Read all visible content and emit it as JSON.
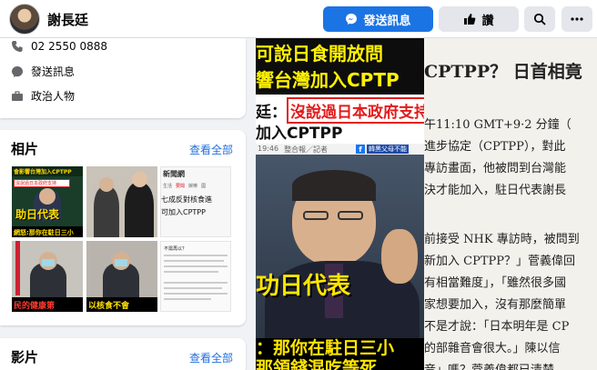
{
  "header": {
    "page_name": "謝長廷",
    "message_button": "發送訊息",
    "like_button": "讚",
    "search_icon": "search-icon",
    "more_icon": "more-icon",
    "accent": "#1b74e4"
  },
  "intro": {
    "phone": "02 2550 0888",
    "message": "發送訊息",
    "category": "政治人物"
  },
  "photos": {
    "title": "相片",
    "see_all": "查看全部",
    "thumb1": {
      "caption_top": "會影響台灣加入CPTPP",
      "red_text": "沒說過日本政府支持",
      "yellow_text": "助日代表",
      "bottom_text": "網怒:那你在駐日三小"
    },
    "thumb2": {},
    "thumb3": {
      "brand": "新聞網",
      "tabs": [
        "生活",
        "要聞",
        "娛樂",
        "國"
      ],
      "line1": "七成反對核食進",
      "line2": "可加入CPTPP"
    },
    "thumb4": {
      "bottom_text": "民的健康第"
    },
    "thumb5": {
      "bottom_text": "以核食不會"
    },
    "thumb6": {
      "title": "不需再以？"
    }
  },
  "videos": {
    "title": "影片",
    "see_all": "查看全部"
  },
  "main_photo": {
    "headline1": "可說日食開放問",
    "headline2": "響台灣加入CPTP",
    "quote_prefix": "廷：",
    "quote_red": "沒說過日本政府支持",
    "quote_line2": "加入CPTPP",
    "timestamp": "19:46",
    "reporter": "整合報／記者",
    "source": "韓黑父母不能",
    "yellow_text": "功日代表",
    "bottom1": "：那你在駐日三小",
    "bottom2": "那領錢混吃等死"
  },
  "right_photo": {
    "lines": [
      "CPTPP？ 日首相竟",
      "午11:10 GMT+9·2 分鐘（",
      "進步協定（CPTPP），對此",
      "專訪畫面，他被問到台灣能",
      "決才能加入，駐日代表謝長",
      "",
      "前接受 NHK 專訪時，被問到",
      "新加入 CPTPP？」菅義偉回",
      "有相當難度」，「雖然很多國",
      "家想要加入，沒有那麼簡單",
      "不是才說：「日本明年是 CP",
      "的部雜音會很大。」陳以信",
      "音」嗎？菅義偉都已清楚"
    ]
  }
}
